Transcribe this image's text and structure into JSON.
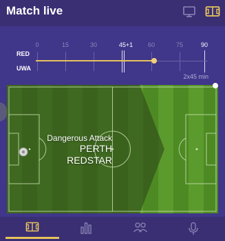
{
  "header": {
    "title": "Match live",
    "monitor_icon": "monitor-icon",
    "field_icon": "field-icon"
  },
  "timeline": {
    "home": "RED",
    "away": "UWA",
    "ticks": [
      "0",
      "15",
      "30",
      "45+1",
      "60",
      "75",
      "90"
    ],
    "duration": "2x45 min",
    "progress_minute": 62,
    "colors": {
      "progress": "#e7c45b",
      "accent": "#f2d07a"
    }
  },
  "pitch": {
    "event": "Dangerous Attack",
    "team_line1": "PERTH",
    "team_line2": "REDSTAR",
    "ball_icon": "ball-icon",
    "colors": {
      "grass_light": "#5b9a2c",
      "grass_dark": "#4d8a23",
      "attack_zone": "#2e4a1a"
    }
  },
  "nav": {
    "items": [
      {
        "name": "pitch-tab",
        "icon": "field-icon",
        "active": true
      },
      {
        "name": "stats-tab",
        "icon": "bar-chart-icon",
        "active": false
      },
      {
        "name": "lineups-tab",
        "icon": "players-icon",
        "active": false
      },
      {
        "name": "commentary-tab",
        "icon": "microphone-icon",
        "active": false
      }
    ]
  }
}
